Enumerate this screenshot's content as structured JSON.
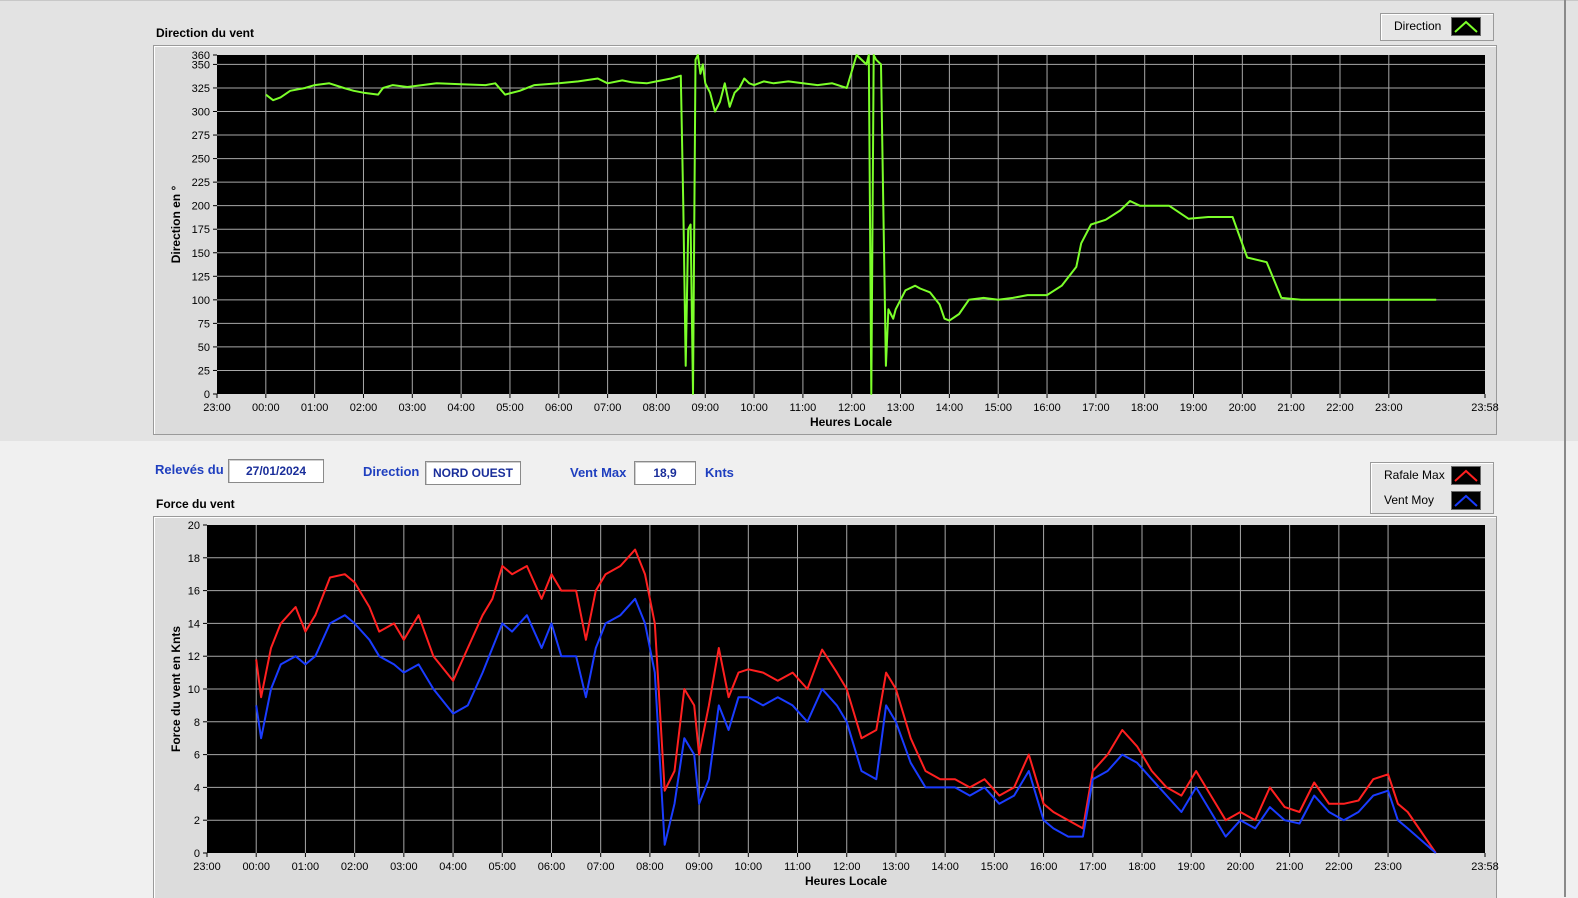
{
  "chart1": {
    "title": "Direction du vent",
    "legend": [
      {
        "label": "Direction",
        "color": "#7cff2a"
      }
    ]
  },
  "controls": {
    "date_label": "Relevés du",
    "date_value": "27/01/2024",
    "direction_label": "Direction",
    "direction_value": "NORD OUEST",
    "ventmax_label": "Vent Max",
    "ventmax_value": "18,9",
    "unit": "Knts"
  },
  "chart2": {
    "title": "Force du vent",
    "legend": [
      {
        "label": "Rafale Max",
        "color": "#ff2020"
      },
      {
        "label": "Vent Moy",
        "color": "#1a3cff"
      }
    ]
  },
  "chart_data": [
    {
      "type": "line",
      "title": "Direction du vent",
      "xlabel": "Heures Locale",
      "ylabel": "Direction en °",
      "xticks": [
        "23:00",
        "00:00",
        "01:00",
        "02:00",
        "03:00",
        "04:00",
        "05:00",
        "06:00",
        "07:00",
        "08:00",
        "09:00",
        "10:00",
        "11:00",
        "12:00",
        "13:00",
        "14:00",
        "15:00",
        "16:00",
        "17:00",
        "18:00",
        "19:00",
        "20:00",
        "21:00",
        "22:00",
        "23:00",
        "23:58"
      ],
      "yticks": [
        0,
        25,
        50,
        75,
        100,
        125,
        150,
        175,
        200,
        225,
        250,
        275,
        300,
        325,
        350,
        360
      ],
      "ylim": [
        0,
        360
      ],
      "xlim_hours": [
        -1,
        24.97
      ],
      "grid": true,
      "series": [
        {
          "name": "Direction",
          "color": "#7cff2a",
          "x": [
            0,
            0.15,
            0.3,
            0.5,
            0.8,
            1.0,
            1.3,
            1.6,
            1.8,
            2.0,
            2.3,
            2.4,
            2.6,
            2.9,
            3.2,
            3.5,
            4.0,
            4.5,
            4.7,
            4.9,
            5.2,
            5.5,
            6.0,
            6.4,
            6.8,
            7.0,
            7.3,
            7.5,
            7.8,
            8.0,
            8.3,
            8.5,
            8.55,
            8.6,
            8.65,
            8.7,
            8.75,
            8.8,
            8.85,
            8.9,
            8.95,
            9.0,
            9.1,
            9.2,
            9.3,
            9.4,
            9.5,
            9.6,
            9.7,
            9.8,
            9.9,
            10.0,
            10.2,
            10.4,
            10.7,
            11.0,
            11.3,
            11.6,
            11.9,
            12.1,
            12.3,
            12.35,
            12.4,
            12.45,
            12.5,
            12.6,
            12.7,
            12.75,
            12.8,
            12.85,
            12.9,
            13.1,
            13.3,
            13.4,
            13.6,
            13.8,
            13.9,
            14.0,
            14.2,
            14.4,
            14.7,
            15.0,
            15.3,
            15.6,
            16.0,
            16.3,
            16.6,
            16.7,
            16.9,
            17.2,
            17.5,
            17.7,
            17.9,
            18.3,
            18.5,
            18.9,
            19.3,
            19.8,
            20.1,
            20.5,
            20.8,
            21.2,
            22.0,
            22.5,
            23.0,
            23.5,
            23.97
          ],
          "y": [
            318,
            312,
            315,
            322,
            325,
            328,
            330,
            325,
            322,
            320,
            318,
            325,
            328,
            326,
            328,
            330,
            329,
            328,
            330,
            318,
            322,
            328,
            330,
            332,
            335,
            330,
            333,
            331,
            330,
            332,
            335,
            338,
            200,
            30,
            175,
            180,
            0,
            355,
            360,
            340,
            350,
            330,
            320,
            300,
            310,
            330,
            305,
            320,
            325,
            335,
            330,
            328,
            332,
            330,
            332,
            330,
            328,
            330,
            325,
            360,
            350,
            360,
            0,
            360,
            355,
            350,
            30,
            90,
            85,
            80,
            90,
            110,
            115,
            112,
            108,
            95,
            80,
            78,
            85,
            100,
            102,
            100,
            102,
            105,
            105,
            115,
            135,
            160,
            180,
            185,
            195,
            205,
            200,
            200,
            200,
            186,
            188,
            188,
            145,
            140,
            102,
            100,
            100,
            100,
            100,
            100,
            100
          ]
        }
      ]
    },
    {
      "type": "line",
      "title": "Force du vent",
      "xlabel": "Heures Locale",
      "ylabel": "Force du vent en Knts",
      "xticks": [
        "23:00",
        "00:00",
        "01:00",
        "02:00",
        "03:00",
        "04:00",
        "05:00",
        "06:00",
        "07:00",
        "08:00",
        "09:00",
        "10:00",
        "11:00",
        "12:00",
        "13:00",
        "14:00",
        "15:00",
        "16:00",
        "17:00",
        "18:00",
        "19:00",
        "20:00",
        "21:00",
        "22:00",
        "23:00",
        "23:58"
      ],
      "yticks": [
        0,
        2,
        4,
        6,
        8,
        10,
        12,
        14,
        16,
        18,
        20
      ],
      "ylim": [
        0,
        20
      ],
      "xlim_hours": [
        -1,
        24.97
      ],
      "grid": true,
      "series": [
        {
          "name": "Rafale Max",
          "color": "#ff2020",
          "x": [
            0,
            0.1,
            0.3,
            0.5,
            0.8,
            1.0,
            1.2,
            1.5,
            1.8,
            2.0,
            2.3,
            2.5,
            2.8,
            3.0,
            3.3,
            3.6,
            4.0,
            4.3,
            4.6,
            4.8,
            5.0,
            5.2,
            5.5,
            5.8,
            6.0,
            6.2,
            6.5,
            6.7,
            6.9,
            7.1,
            7.4,
            7.7,
            7.9,
            8.1,
            8.3,
            8.5,
            8.7,
            8.9,
            9.0,
            9.2,
            9.4,
            9.6,
            9.8,
            10.0,
            10.3,
            10.6,
            10.9,
            11.2,
            11.5,
            11.8,
            12.0,
            12.3,
            12.6,
            12.8,
            13.0,
            13.3,
            13.6,
            13.9,
            14.2,
            14.5,
            14.8,
            15.1,
            15.4,
            15.7,
            16.0,
            16.2,
            16.5,
            16.8,
            17.0,
            17.3,
            17.6,
            17.9,
            18.2,
            18.5,
            18.8,
            19.1,
            19.4,
            19.7,
            20.0,
            20.3,
            20.6,
            20.9,
            21.2,
            21.5,
            21.8,
            22.1,
            22.4,
            22.7,
            23.0,
            23.2,
            23.4,
            23.97
          ],
          "y": [
            11.8,
            9.5,
            12.5,
            14,
            15,
            13.5,
            14.5,
            16.8,
            17,
            16.5,
            15,
            13.5,
            14,
            13,
            14.5,
            12,
            10.5,
            12.5,
            14.5,
            15.5,
            17.5,
            17,
            17.5,
            15.5,
            17,
            16,
            16,
            13,
            16,
            17,
            17.5,
            18.5,
            17,
            14,
            3.8,
            5,
            10,
            9,
            6,
            9,
            12.5,
            9.5,
            11,
            11.2,
            11,
            10.5,
            11,
            10,
            12.4,
            11,
            10,
            7,
            7.5,
            11,
            10,
            7,
            5,
            4.5,
            4.5,
            4,
            4.5,
            3.5,
            4,
            6,
            3,
            2.5,
            2,
            1.5,
            5,
            6,
            7.5,
            6.5,
            5,
            4,
            3.5,
            5,
            3.5,
            2,
            2.5,
            2,
            4,
            2.8,
            2.5,
            4.3,
            3,
            3,
            3.2,
            4.5,
            4.8,
            3,
            2.5,
            0
          ]
        },
        {
          "name": "Vent Moy",
          "color": "#1a3cff",
          "x": [
            0,
            0.1,
            0.3,
            0.5,
            0.8,
            1.0,
            1.2,
            1.5,
            1.8,
            2.0,
            2.3,
            2.5,
            2.8,
            3.0,
            3.3,
            3.6,
            4.0,
            4.3,
            4.6,
            4.8,
            5.0,
            5.2,
            5.5,
            5.8,
            6.0,
            6.2,
            6.5,
            6.7,
            6.9,
            7.1,
            7.4,
            7.7,
            7.9,
            8.1,
            8.3,
            8.5,
            8.7,
            8.9,
            9.0,
            9.2,
            9.4,
            9.6,
            9.8,
            10.0,
            10.3,
            10.6,
            10.9,
            11.2,
            11.5,
            11.8,
            12.0,
            12.3,
            12.6,
            12.8,
            13.0,
            13.3,
            13.6,
            13.9,
            14.2,
            14.5,
            14.8,
            15.1,
            15.4,
            15.7,
            16.0,
            16.2,
            16.5,
            16.8,
            17.0,
            17.3,
            17.6,
            17.9,
            18.2,
            18.5,
            18.8,
            19.1,
            19.4,
            19.7,
            20.0,
            20.3,
            20.6,
            20.9,
            21.2,
            21.5,
            21.8,
            22.1,
            22.4,
            22.7,
            23.0,
            23.2,
            23.4,
            23.97
          ],
          "y": [
            9,
            7,
            10,
            11.5,
            12,
            11.5,
            12,
            14,
            14.5,
            14,
            13,
            12,
            11.5,
            11,
            11.5,
            10,
            8.5,
            9,
            11,
            12.5,
            14,
            13.5,
            14.5,
            12.5,
            14,
            12,
            12,
            9.5,
            12.5,
            14,
            14.5,
            15.5,
            14,
            11,
            0.5,
            3,
            7,
            6,
            3,
            4.5,
            9,
            7.5,
            9.5,
            9.5,
            9,
            9.5,
            9,
            8,
            10,
            9,
            8,
            5,
            4.5,
            9,
            8,
            5.5,
            4,
            4,
            4,
            3.5,
            4,
            3,
            3.5,
            5,
            2,
            1.5,
            1,
            1,
            4.5,
            5,
            6,
            5.5,
            4.5,
            3.5,
            2.5,
            4,
            2.5,
            1,
            2,
            1.5,
            2.8,
            2,
            1.8,
            3.5,
            2.5,
            2,
            2.5,
            3.5,
            3.8,
            2,
            1.5,
            0
          ]
        }
      ]
    }
  ]
}
